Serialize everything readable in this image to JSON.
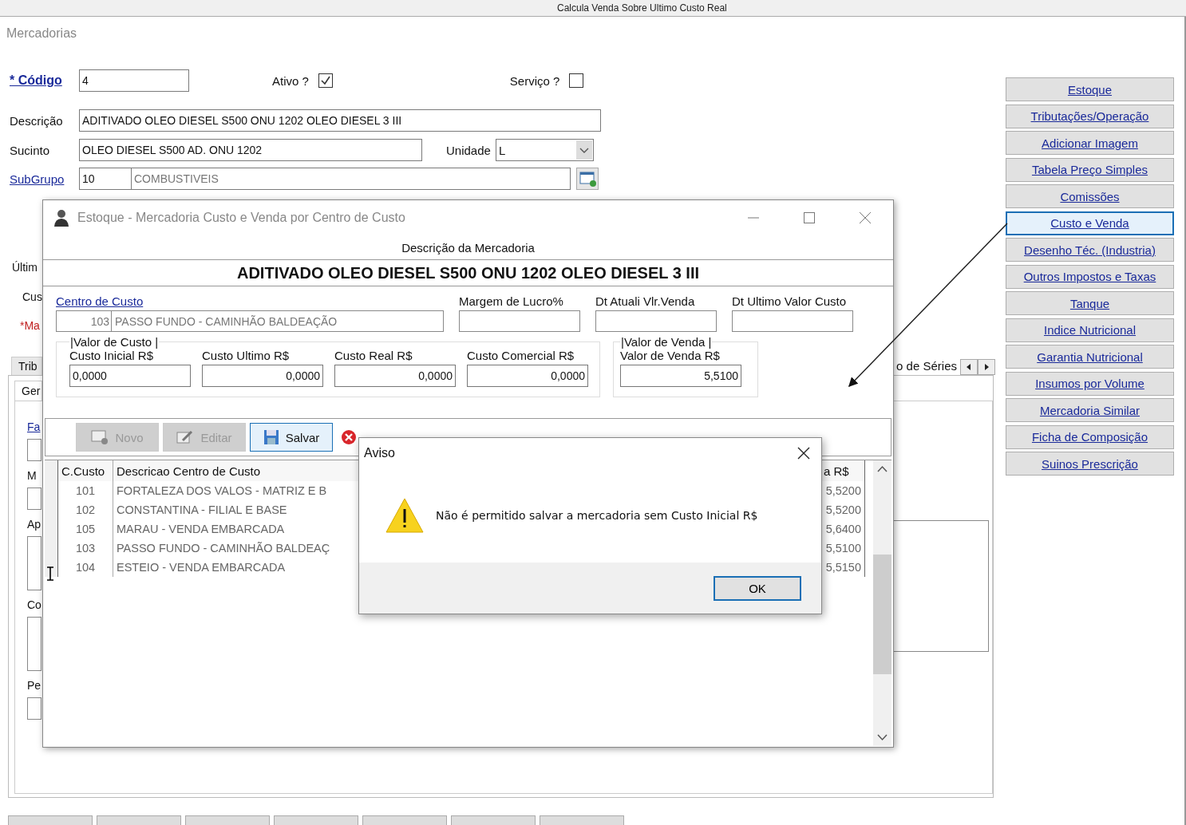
{
  "top_bar": {
    "text": "Calcula Venda Sobre Ultimo Custo Real"
  },
  "form": {
    "title": "Mercadorias",
    "codigo": {
      "label": "* Código",
      "value": "4"
    },
    "ativo": {
      "label": "Ativo ?",
      "checked": true
    },
    "servico": {
      "label": "Serviço ?",
      "checked": false
    },
    "descricao": {
      "label": "Descrição",
      "value": "ADITIVADO OLEO DIESEL S500 ONU 1202 OLEO DIESEL 3 III"
    },
    "sucinto": {
      "label": "Sucinto",
      "value": "OLEO DIESEL S500 AD. ONU 1202"
    },
    "unidade": {
      "label": "Unidade",
      "value": "L"
    },
    "subgrupo": {
      "label": "SubGrupo",
      "code": "10",
      "name": "COMBUSTIVEIS"
    },
    "cut_labels": [
      {
        "text": "Últim",
        "required": false
      },
      {
        "text": "Cus",
        "required": false
      },
      {
        "text": "*Ma",
        "required": true
      }
    ],
    "tab": "Trib",
    "tab_right": "o de Séries",
    "inner_tab": "Ger",
    "inner_fields": [
      {
        "label": "Fa",
        "link": true,
        "kind": "field"
      },
      {
        "label": "M",
        "link": false,
        "kind": "field"
      },
      {
        "label": "Ap",
        "link": false,
        "kind": "memo"
      },
      {
        "label": "Co",
        "link": false,
        "kind": "memo"
      },
      {
        "label": "Pe",
        "link": false,
        "kind": "field"
      }
    ]
  },
  "side_buttons": [
    {
      "label": "Estoque",
      "selected": false
    },
    {
      "label": "Tributações/Operação",
      "selected": false
    },
    {
      "label": "Adicionar Imagem",
      "selected": false
    },
    {
      "label": "Tabela Preço Simples",
      "selected": false
    },
    {
      "label": "Comissões",
      "selected": false
    },
    {
      "label": "Custo e Venda",
      "selected": true
    },
    {
      "label": "Desenho Téc. (Industria)",
      "selected": false
    },
    {
      "label": "Outros Impostos e Taxas",
      "selected": false
    },
    {
      "label": "Tanque",
      "selected": false
    },
    {
      "label": "Indice Nutricional",
      "selected": false
    },
    {
      "label": "Garantia Nutricional",
      "selected": false
    },
    {
      "label": "Insumos por Volume",
      "selected": false
    },
    {
      "label": "Mercadoria Similar",
      "selected": false
    },
    {
      "label": "Ficha de Composição",
      "selected": false
    },
    {
      "label": "Suinos Prescrição",
      "selected": false
    }
  ],
  "cost_window": {
    "title": "Estoque - Mercadoria Custo e Venda por Centro de Custo",
    "caption": "Descrição da Mercadoria",
    "description": "ADITIVADO OLEO DIESEL S500 ONU 1202 OLEO DIESEL 3 III",
    "centro": {
      "label": "Centro de Custo",
      "code": "103",
      "name": "PASSO FUNDO - CAMINHÃO BALDEAÇÃO"
    },
    "extra_fields": [
      {
        "label": "Margem de Lucro%"
      },
      {
        "label": "Dt Atuali Vlr.Venda"
      },
      {
        "label": "Dt Ultimo Valor Custo"
      }
    ],
    "groups": [
      {
        "title": "|Valor de Custo |",
        "fields": [
          {
            "label": "Custo Inicial R$",
            "value": "0,0000",
            "kind": "editing"
          },
          {
            "label": "Custo Ultimo R$",
            "value": "0,0000",
            "kind": "display"
          },
          {
            "label": "Custo Real R$",
            "value": "0,0000",
            "kind": "display"
          },
          {
            "label": "Custo Comercial R$",
            "value": "0,0000",
            "kind": "display"
          }
        ]
      },
      {
        "title": "|Valor de Venda |",
        "fields": [
          {
            "label": "Valor de Venda R$",
            "value": "5,5100",
            "kind": "display"
          }
        ]
      }
    ],
    "toolbar": [
      {
        "kind": "new",
        "label": "Novo",
        "disabled": true
      },
      {
        "kind": "edit",
        "label": "Editar",
        "disabled": true
      },
      {
        "kind": "save",
        "label": "Salvar",
        "disabled": false
      },
      {
        "kind": "delete",
        "disabled": false
      }
    ],
    "table": {
      "columns": [
        "C.Custo",
        "Descricao Centro de Custo",
        "a R$"
      ],
      "rows": [
        {
          "code": "101",
          "name": "FORTALEZA DOS VALOS - MATRIZ E B",
          "price": "5,5200"
        },
        {
          "code": "102",
          "name": "CONSTANTINA - FILIAL E BASE",
          "price": "5,5200"
        },
        {
          "code": "105",
          "name": "MARAU - VENDA EMBARCADA",
          "price": "5,6400"
        },
        {
          "code": "103",
          "name": "PASSO FUNDO - CAMINHÃO BALDEAÇ",
          "price": "5,5100"
        },
        {
          "code": "104",
          "name": "ESTEIO - VENDA EMBARCADA",
          "price": "5,5150"
        }
      ]
    }
  },
  "alert": {
    "title": "Aviso",
    "message": "Não é permitido salvar a mercadoria sem Custo Inicial R$",
    "button": "OK"
  }
}
